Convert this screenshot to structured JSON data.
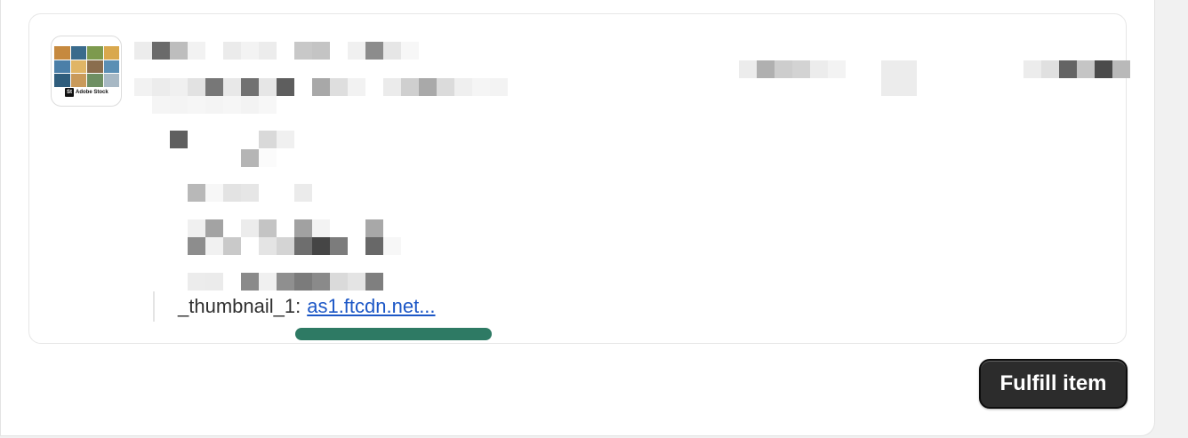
{
  "thumbnail": {
    "brand_label": "Adobe Stock",
    "brand_mark": "St",
    "tile_colors": [
      "#c6893f",
      "#3a6b8c",
      "#7d9a4e",
      "#d9a84e",
      "#4b7fa8",
      "#e0b566",
      "#8a6d4e",
      "#5b8fb4",
      "#2f5d7c",
      "#c99a5a",
      "#6e8f63",
      "#a7b8c4"
    ]
  },
  "property": {
    "key": "_thumbnail_1:",
    "link_text": "as1.ftcdn.net..."
  },
  "actions": {
    "fulfill_label": "Fulfill item"
  },
  "colors": {
    "link": "#1c57c6",
    "highlight": "#2e7a64",
    "button_bg": "#2c2c2c"
  }
}
